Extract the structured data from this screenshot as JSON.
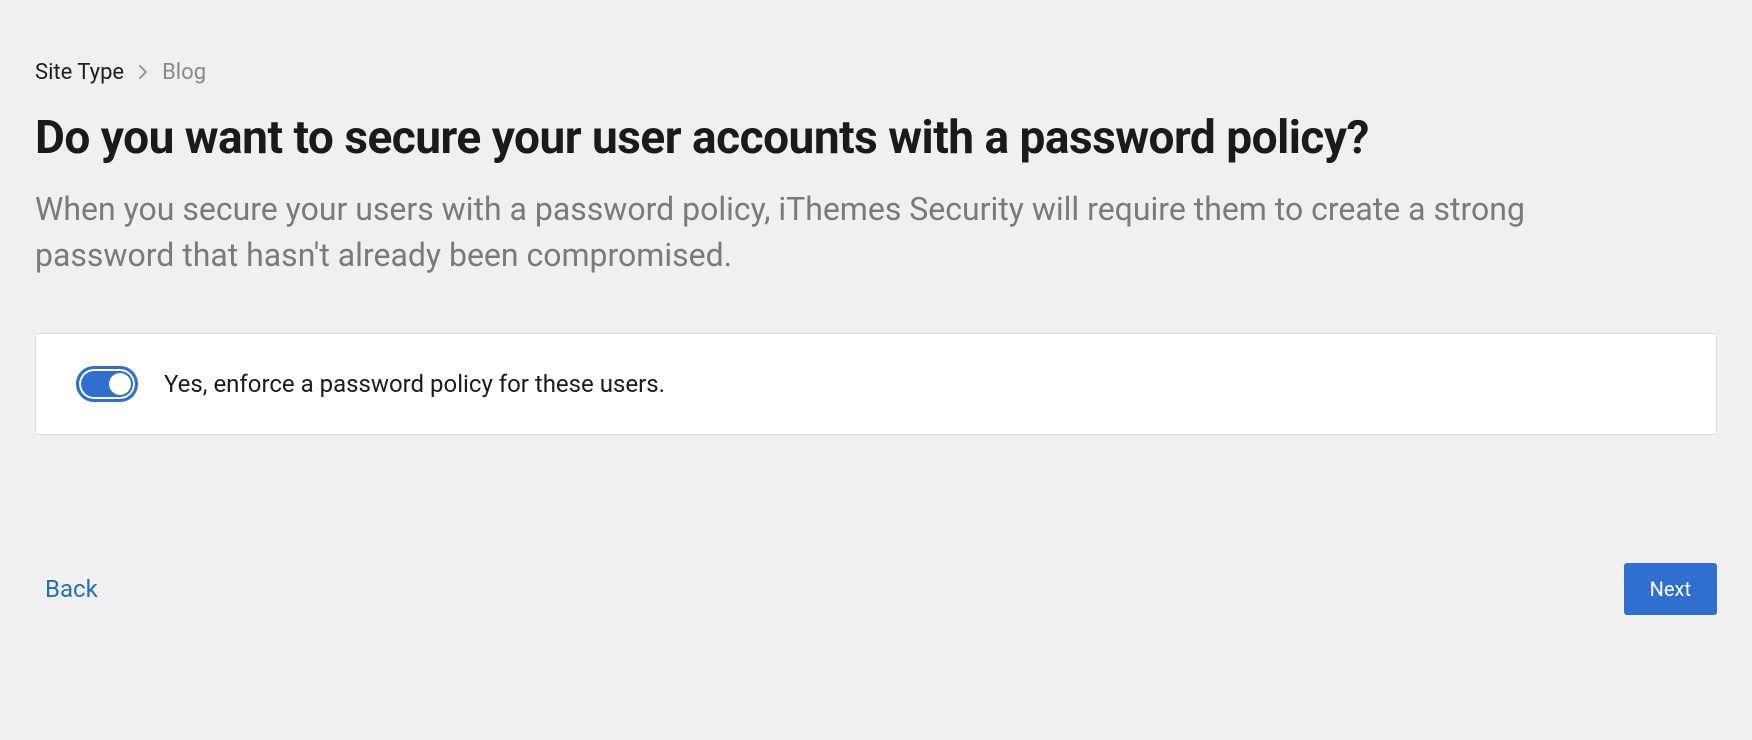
{
  "breadcrumb": {
    "parent": "Site Type",
    "current": "Blog"
  },
  "page": {
    "title": "Do you want to secure your user accounts with a password policy?",
    "subtitle": "When you secure your users with a password policy, iThemes Security will require them to create a strong password that hasn't already been compromised."
  },
  "option": {
    "label": "Yes, enforce a password policy for these users.",
    "enabled": true
  },
  "nav": {
    "back": "Back",
    "next": "Next"
  }
}
